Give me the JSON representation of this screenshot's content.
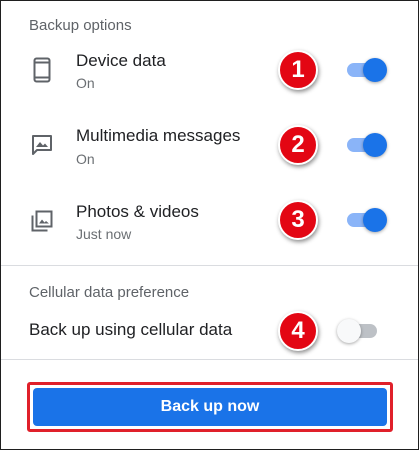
{
  "backup_options": {
    "header": "Backup options",
    "items": [
      {
        "icon": "phone-icon",
        "title": "Device data",
        "subtitle": "On",
        "badge": "1",
        "enabled": true
      },
      {
        "icon": "image-message-icon",
        "title": "Multimedia messages",
        "subtitle": "On",
        "badge": "2",
        "enabled": true
      },
      {
        "icon": "photo-library-icon",
        "title": "Photos & videos",
        "subtitle": "Just now",
        "badge": "3",
        "enabled": true
      }
    ]
  },
  "cellular": {
    "header": "Cellular data preference",
    "label": "Back up using cellular data",
    "badge": "4",
    "enabled": false
  },
  "cta": {
    "label": "Back up now"
  },
  "colors": {
    "accent": "#1a73e8",
    "toggle_track_on": "#8ab4f8",
    "badge_red": "#e30613",
    "highlight_outline": "#e0202a"
  }
}
